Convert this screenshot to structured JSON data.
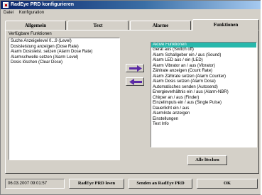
{
  "window": {
    "title": "RadEye PRD konfigurieren"
  },
  "menu": [
    "Datei",
    "Konfiguration"
  ],
  "tabs": [
    {
      "label": "Allgemein"
    },
    {
      "label": "Text"
    },
    {
      "label": "Alarme"
    },
    {
      "label": "Funktionen",
      "active": true
    }
  ],
  "available": {
    "label": "Verfügbare Funktionen",
    "items": [
      "Suche Anzeigelevel 0...9 (Level)",
      "Dosisleistung anzeigen (Dose Rate)",
      "Alarm Dosisleist. setzen (Alarm Dose Rate)",
      "Alarmschwelle setzen (Alarm Level)",
      "Dosis löschen (Clear Dose)"
    ]
  },
  "active": {
    "label": "Aktive Funktionen",
    "items": [
      "Gerät aus (Switch off)",
      "Alarm Schallgeber ein / aus (Sound)",
      "Alarm LED aus / ein (LED)",
      "Alarm Vibrator an / aus (Vibrator)",
      "Zählrate anzeigen (Count Rate)",
      "Alarm Zählrate setzen (Alarm Counter)",
      "Alarm Dosis setzen (Alarm Dose)",
      "Automatisches senden (Autosend)",
      "Energieverhältnis ein / aus (Alarm-NBR)",
      "Chirper an / aus (Finder)",
      "Einzelimpuls ein / aus (Single Pulse)",
      "Dauerlicht ein / aus",
      "Alarmliste anzeigen",
      "Einstellungen",
      "Text Info"
    ]
  },
  "buttons": {
    "add_icon": "arrow-right-icon",
    "remove_icon": "arrow-left-icon",
    "clear_all": "Alle löschen",
    "read": "RadEye PRD lesen",
    "send": "Senden an RadEye PRD",
    "ok": "OK"
  },
  "status": {
    "datetime": "06.03.2007  09:01:57"
  },
  "colors": {
    "titlebar": "#0a246a",
    "selection": "#27b8ac",
    "arrows": "#5b2aa6"
  }
}
